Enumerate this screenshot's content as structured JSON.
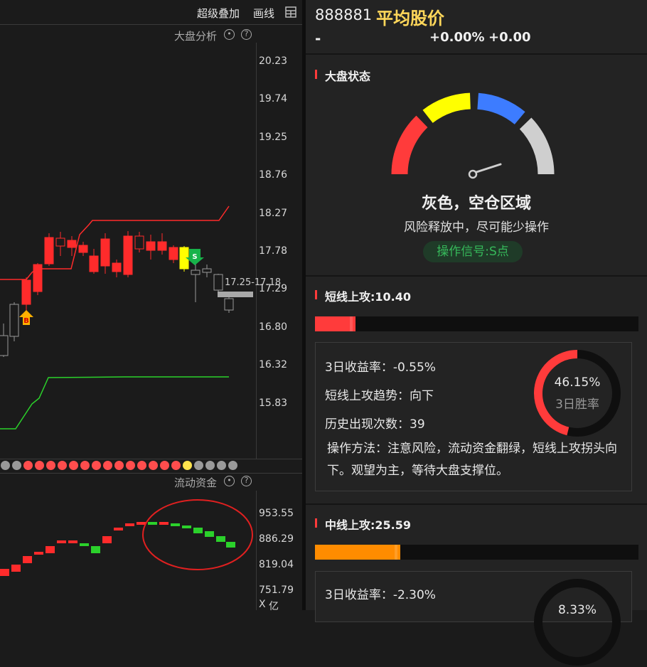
{
  "toolbar": {
    "overlay_label": "超级叠加",
    "draw_label": "画线"
  },
  "kline_panel": {
    "title": "大盘分析",
    "y_ticks": [
      "20.23",
      "19.74",
      "19.25",
      "18.76",
      "18.27",
      "17.78",
      "17.29",
      "16.80",
      "16.32",
      "15.83"
    ],
    "price_label": "17.25-17.18",
    "buy_marker": "B",
    "sell_marker": "S"
  },
  "dot_row": {
    "colors": [
      "#999999",
      "#999999",
      "#ff4d4d",
      "#ff4d4d",
      "#ff4d4d",
      "#ff4d4d",
      "#ff4d4d",
      "#ff4d4d",
      "#ff4d4d",
      "#ff4d4d",
      "#ff4d4d",
      "#ff4d4d",
      "#ff4d4d",
      "#ff4d4d",
      "#ff4d4d",
      "#ff4d4d",
      "#ffe34d",
      "#999999",
      "#999999",
      "#999999",
      "#999999"
    ]
  },
  "flow_panel": {
    "title": "流动资金",
    "y_ticks": [
      "953.55",
      "886.29",
      "819.04",
      "751.79"
    ],
    "unit": "亿"
  },
  "header": {
    "code": "888881",
    "name": "平均股价",
    "price": "-",
    "pct": "+0.00%",
    "change": "+0.00"
  },
  "market_state": {
    "title": "大盘状态",
    "zone": "灰色，空仓区域",
    "desc": "风险释放中，尽可能少操作",
    "signal": "操作信号:S点",
    "gauge_colors": [
      "#ff3b3b",
      "#ffff00",
      "#3d7cff",
      "#cfcfcf"
    ]
  },
  "short_attack": {
    "title": "短线上攻:10.40",
    "bar_value": 10.4,
    "bar_color": "#ff3b3b",
    "return_3d": "3日收益率：-0.55%",
    "trend": "短线上攻趋势：向下",
    "occurrences": "历史出现次数：39",
    "method": "操作方法：注意风险，流动资金翻绿，短线上攻拐头向下。观望为主，等待大盘支撑位。",
    "win_rate": "46.15%",
    "win_rate_value": 46.15,
    "win_rate_label": "3日胜率"
  },
  "mid_attack": {
    "title": "中线上攻:25.59",
    "bar_value": 25.59,
    "bar_color": "#ff8c00",
    "return_3d": "3日收益率：-2.30%",
    "win_rate": "8.33%"
  }
}
